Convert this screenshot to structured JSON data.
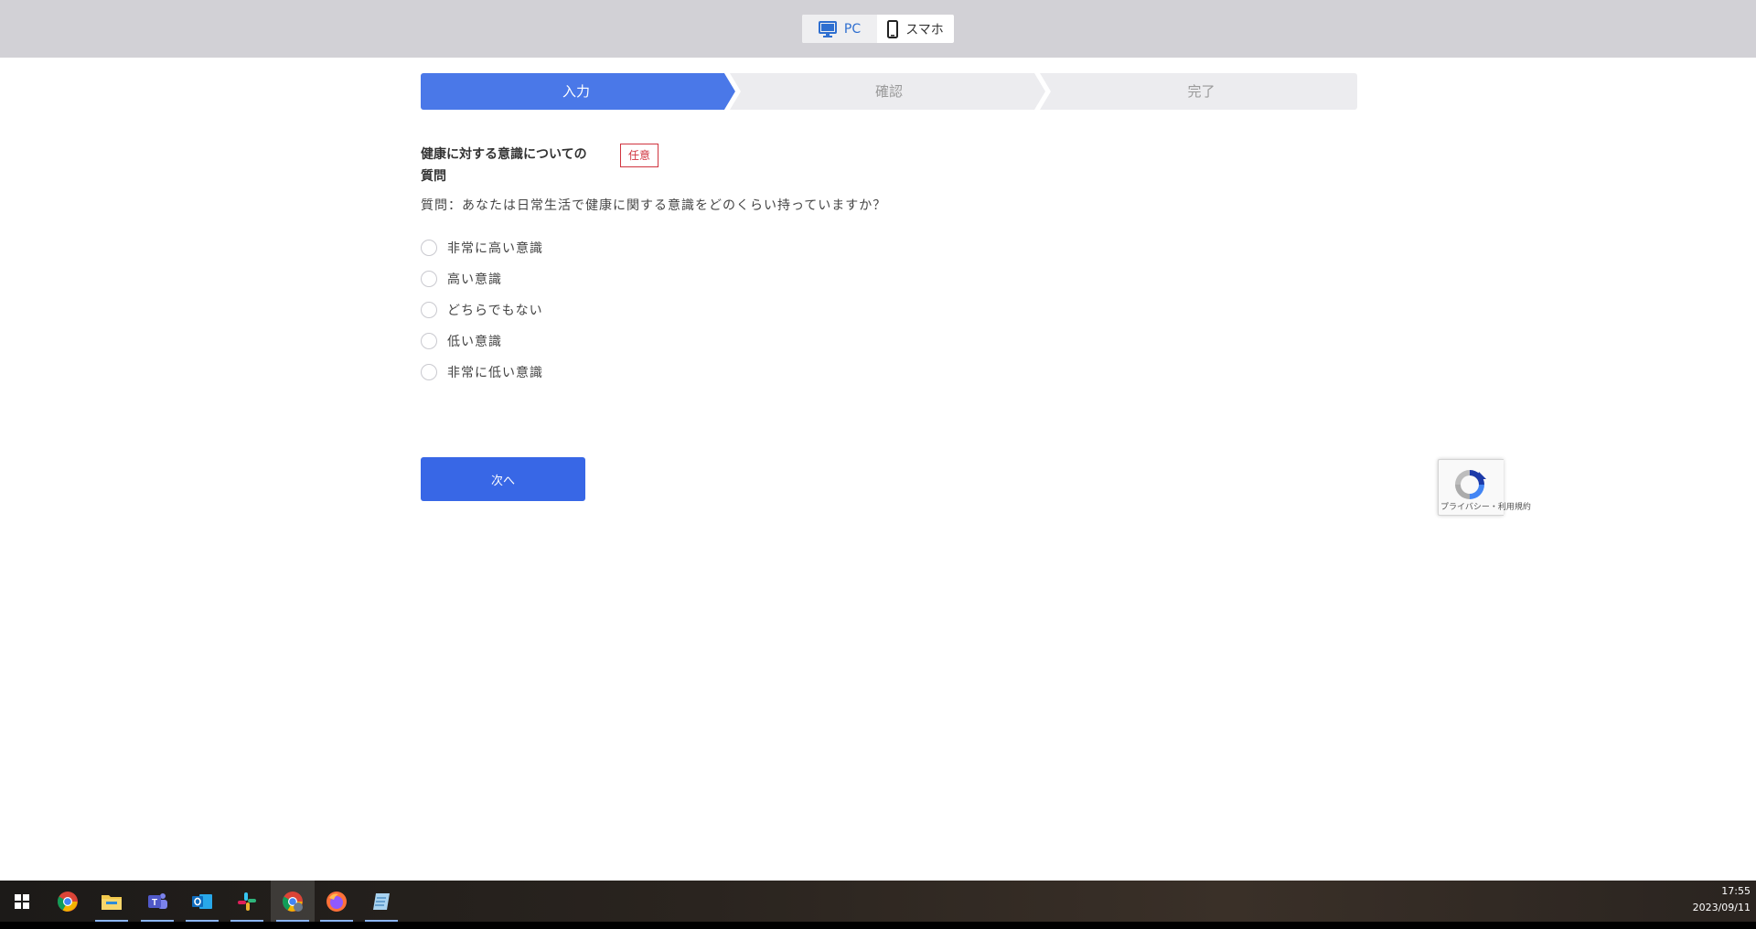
{
  "device_toggle": {
    "pc_label": "PC",
    "sp_label": "スマホ"
  },
  "steps": [
    {
      "label": "入力",
      "active": true
    },
    {
      "label": "確認",
      "active": false
    },
    {
      "label": "完了",
      "active": false
    }
  ],
  "question": {
    "title_line1": "健康に対する意識についての",
    "title_line2": "質問",
    "badge": "任意",
    "text": "質問：あなたは日常生活で健康に関する意識をどのくらい持っていますか？",
    "options": [
      "非常に高い意識",
      "高い意識",
      "どちらでもない",
      "低い意識",
      "非常に低い意識"
    ]
  },
  "next_button": "次へ",
  "recaptcha": {
    "links": "プライバシー・利用規約"
  },
  "taskbar": {
    "icons": [
      "windows-start-icon",
      "chrome-icon",
      "file-explorer-icon",
      "teams-icon",
      "outlook-icon",
      "slack-icon",
      "chrome-profile-icon",
      "firefox-icon",
      "notepad-icon"
    ],
    "time": "17:55",
    "date": "2023/09/11"
  },
  "colors": {
    "accent": "#3867e6",
    "step_active": "#4a78e8",
    "step_inactive": "#ececef",
    "badge": "#d0343f",
    "topbar": "#d2d1d6"
  }
}
